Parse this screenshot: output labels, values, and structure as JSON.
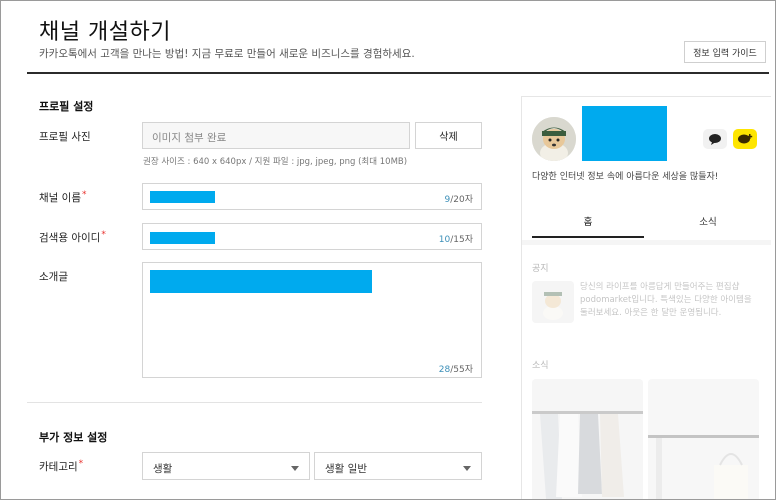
{
  "header": {
    "title": "채널 개설하기",
    "subtitle": "카카오톡에서 고객을 만나는 방법! 지금 무료로 만들어 새로운 비즈니스를 경험하세요.",
    "guide_button": "정보 입력 가이드"
  },
  "profile": {
    "section_title": "프로필 설정",
    "photo_label": "프로필 사진",
    "photo_value": "이미지 첨부 완료",
    "delete_button": "삭제",
    "photo_hint": "권장 사이즈 : 640 x 640px / 지원 파일 : jpg, jpeg, png (최대 10MB)",
    "name_label": "채널 이름",
    "name_count": "9",
    "name_max": "/20자",
    "search_id_label": "검색용 아이디",
    "search_id_count": "10",
    "search_id_max": "/15자",
    "intro_label": "소개글",
    "intro_count": "28",
    "intro_max": "/55자",
    "required_mark": "*"
  },
  "extra": {
    "section_title": "부가 정보 설정",
    "category_label": "카테고리",
    "category_primary": "생활",
    "category_secondary": "생활 일반"
  },
  "preview": {
    "description": "다양한 인터넷 정보 속에 아름다운 세상을 많들자!",
    "tabs": [
      "홈",
      "소식"
    ],
    "notice_title": "공지",
    "notice_text": "당신의 라이프를 아름답게 만들어주는 편집샵 podomarket입니다. 특색있는 다양한 아이템을 둘러보세요. 아웃은 한 달만 운영됩니다.",
    "news_title": "소식"
  },
  "colors": {
    "redaction": "#00aaee",
    "accent_yellow": "#fee500",
    "required": "#e8322e",
    "counter": "#3c8fb8"
  }
}
